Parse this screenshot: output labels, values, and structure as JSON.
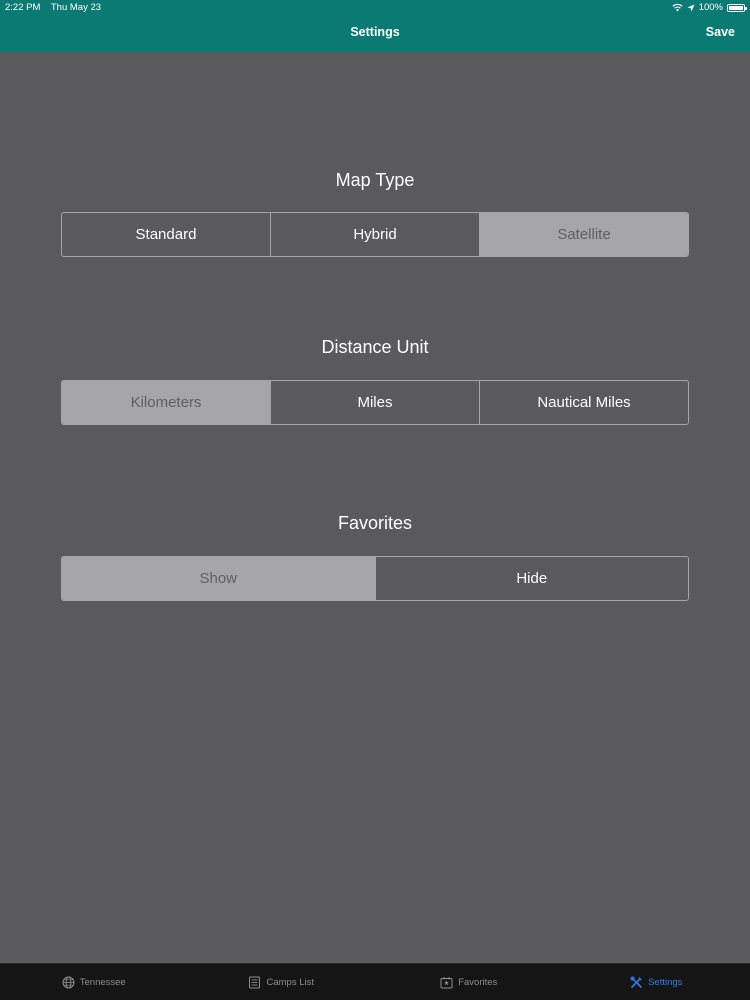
{
  "status_bar": {
    "time": "2:22 PM",
    "date": "Thu May 23",
    "battery": "100%"
  },
  "header": {
    "title": "Settings",
    "save_label": "Save"
  },
  "sections": {
    "map_type": {
      "title": "Map Type",
      "options": [
        "Standard",
        "Hybrid",
        "Satellite"
      ],
      "selected": "Satellite"
    },
    "distance_unit": {
      "title": "Distance Unit",
      "options": [
        "Kilometers",
        "Miles",
        "Nautical Miles"
      ],
      "selected": "Kilometers"
    },
    "favorites": {
      "title": "Favorites",
      "options": [
        "Show",
        "Hide"
      ],
      "selected": "Show"
    }
  },
  "tabbar": {
    "items": [
      {
        "label": "Tennessee",
        "icon": "globe-icon"
      },
      {
        "label": "Camps List",
        "icon": "list-icon"
      },
      {
        "label": "Favorites",
        "icon": "favorites-icon"
      },
      {
        "label": "Settings",
        "icon": "tools-icon"
      }
    ],
    "active": "Settings"
  },
  "colors": {
    "header": "#0b7a73",
    "background": "#5a5a5c",
    "selected_segment": "#a6a6a8",
    "tab_active": "#2f7fe6",
    "tabbar": "#151515"
  }
}
